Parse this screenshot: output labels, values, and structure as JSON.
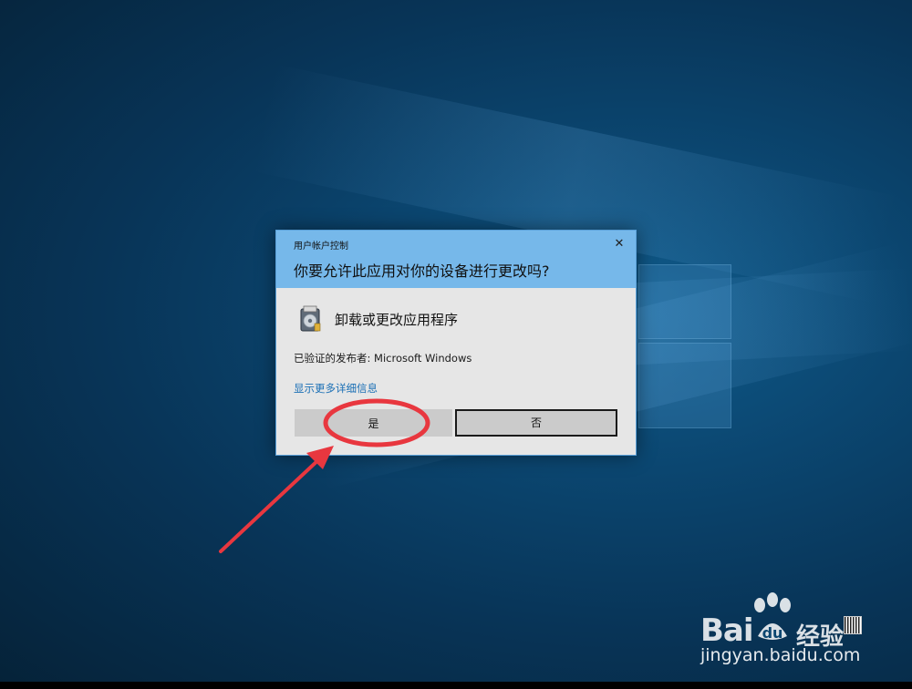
{
  "dialog": {
    "caption": "用户帐户控制",
    "close_glyph": "✕",
    "question": "你要允许此应用对你的设备进行更改吗?",
    "app_name": "卸载或更改应用程序",
    "publisher": "已验证的发布者: Microsoft Windows",
    "details_link": "显示更多详细信息",
    "yes_label": "是",
    "no_label": "否",
    "header_color": "#76b8ea",
    "link_color": "#1a6fb5"
  },
  "annotation": {
    "color": "#e8373f"
  },
  "watermark": {
    "brand_left": "Bai",
    "brand_right": "经验",
    "url": "jingyan.baidu.com"
  },
  "icons": {
    "close": "close-icon",
    "app": "installer-icon",
    "paw": "paw-icon"
  }
}
